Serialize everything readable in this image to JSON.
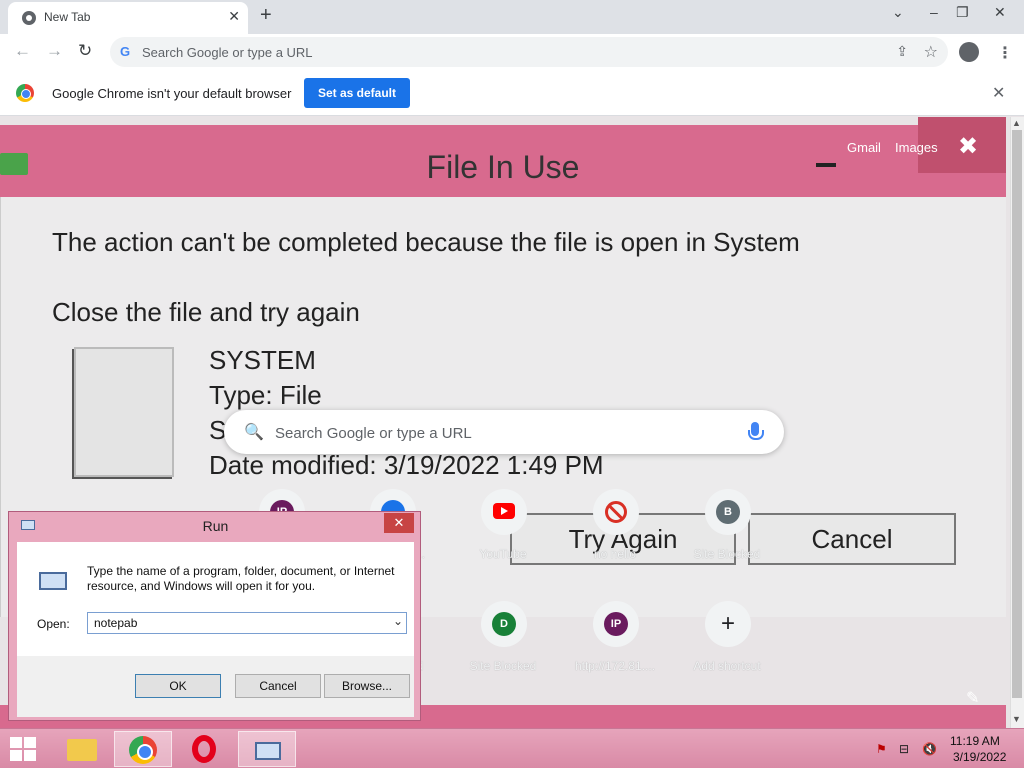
{
  "browser": {
    "tab_title": "New Tab",
    "tab_close": "✕",
    "new_tab": "+",
    "window_controls": {
      "tabsearch": "⌄",
      "minimize": "–",
      "restore": "❐",
      "close": "✕"
    },
    "nav": {
      "back": "←",
      "forward": "→",
      "reload": "↻"
    },
    "omnibox_g": "G",
    "omnibox_placeholder": "Search Google or type a URL",
    "omnibox_share": "⇪",
    "omnibox_star": "☆",
    "menu": "⋮"
  },
  "infobar": {
    "message": "Google Chrome isn't your default browser",
    "button": "Set as default",
    "close": "✕"
  },
  "newtab": {
    "gmail": "Gmail",
    "images": "Images",
    "search_icon": "🔍",
    "search_placeholder": "Search Google or type a URL",
    "edit": "✎",
    "shortcuts": [
      {
        "label": "",
        "letter": "IP",
        "color": "#6a1b5e"
      },
      {
        "label": "...",
        "letter": "",
        "color": "#1a73e8"
      },
      {
        "label": "YouTube",
        "letter": "",
        "color": "#ff0000"
      },
      {
        "label": "no hello",
        "letter": "",
        "color": "#d93025"
      },
      {
        "label": "Site Blocked",
        "letter": "B",
        "color": "#5f6d73"
      },
      {
        "label": "d",
        "letter": "",
        "color": "#888888"
      },
      {
        "label": "Site Blocked",
        "letter": "D",
        "color": "#188038"
      },
      {
        "label": "http://172.81....",
        "letter": "IP",
        "color": "#6a1b5e"
      },
      {
        "label": "Add shortcut",
        "letter": "+",
        "color": "#202124"
      }
    ]
  },
  "background_popup": {
    "title": "File In Use",
    "close": "✖",
    "message1": "The action can't be completed because the file is open in System",
    "message2": "Close the file and try again",
    "file_name": "SYSTEM",
    "file_type": "Type: File",
    "file_size": "S",
    "date_modified": "Date modified: 3/19/2022 1:49 PM",
    "try_again": "Try Again",
    "cancel": "Cancel"
  },
  "run_dialog": {
    "title": "Run",
    "close": "✕",
    "description": "Type the name of a program, folder, document, or Internet resource, and Windows will open it for you.",
    "open_label": "Open:",
    "open_value": "notepab",
    "dropdown": "⌄",
    "ok": "OK",
    "cancel": "Cancel",
    "browse": "Browse..."
  },
  "scrollbar": {
    "up": "▲",
    "down": "▼"
  },
  "taskbar": {
    "tray_icons": [
      "⚑",
      "⊟",
      "🔇"
    ],
    "time": "11:19 AM",
    "date": "3/19/2022"
  }
}
